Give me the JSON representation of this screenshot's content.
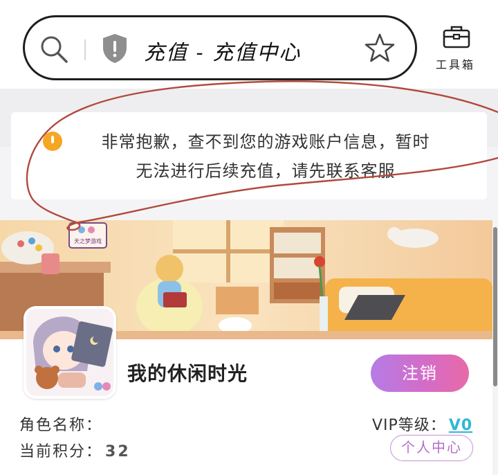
{
  "header": {
    "page_title": "充值 - 充值中心",
    "toolbox_label": "工具箱"
  },
  "notice": {
    "line1": "非常抱歉，查不到您的游戏账户信息，暂时",
    "line2": "无法进行后续充值，请先联系客服"
  },
  "banner": {
    "sign_text": "天之梦游戏"
  },
  "profile": {
    "username": "我的休闲时光",
    "logout_label": "注销",
    "role_label": "角色名称：",
    "points_label": "当前积分：",
    "points_value": "32",
    "vip_label": "VIP等级：",
    "vip_value": "V0",
    "center_label": "个人中心"
  },
  "colors": {
    "accent_gradient_start": "#b57ce6",
    "accent_gradient_end": "#e86aa8",
    "vip_color": "#2eb8d6",
    "warning_color": "#f5a623",
    "scribble_color": "#b04a3c"
  }
}
